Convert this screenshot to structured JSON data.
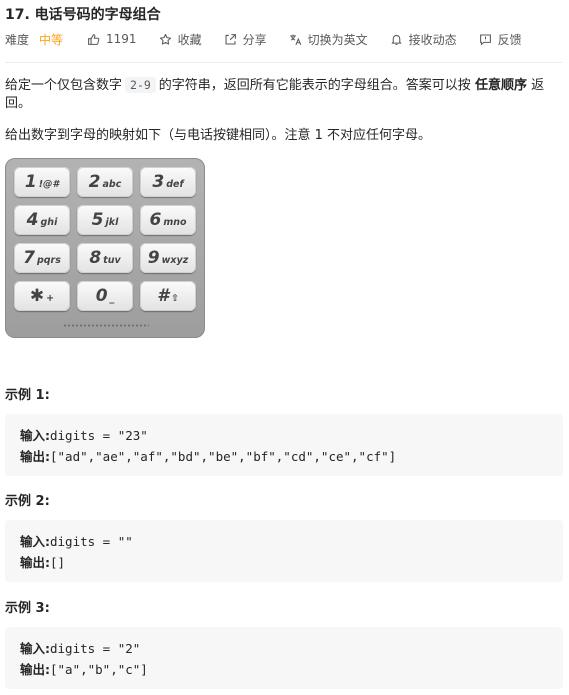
{
  "problem": {
    "title": "17. 电话号码的字母组合",
    "difficulty_label": "难度",
    "difficulty": "中等",
    "likes": "1191",
    "actions": {
      "favorite": "收藏",
      "share": "分享",
      "switch_lang": "切换为英文",
      "subscribe": "接收动态",
      "feedback": "反馈"
    }
  },
  "description": {
    "p1_before": "给定一个仅包含数字",
    "p1_code": "2-9",
    "p1_middle": "的字符串，返回所有它能表示的字母组合。答案可以按",
    "p1_bold": "任意顺序",
    "p1_after": "返回。",
    "p2": "给出数字到字母的映射如下（与电话按键相同）。注意 1 不对应任何字母。"
  },
  "keypad": {
    "keys": [
      {
        "digit": "1",
        "letters": "!@#"
      },
      {
        "digit": "2",
        "letters": "abc"
      },
      {
        "digit": "3",
        "letters": "def"
      },
      {
        "digit": "4",
        "letters": "ghi"
      },
      {
        "digit": "5",
        "letters": "jkl"
      },
      {
        "digit": "6",
        "letters": "mno"
      },
      {
        "digit": "7",
        "letters": "pqrs"
      },
      {
        "digit": "8",
        "letters": "tuv"
      },
      {
        "digit": "9",
        "letters": "wxyz"
      },
      {
        "digit": "✱",
        "letters": "+"
      },
      {
        "digit": "0",
        "letters": "_"
      },
      {
        "digit": "#",
        "letters": "⇧"
      }
    ]
  },
  "examples": [
    {
      "title": "示例 1:",
      "input_label": "输入:",
      "input": "digits = \"23\"",
      "output_label": "输出:",
      "output": "[\"ad\",\"ae\",\"af\",\"bd\",\"be\",\"bf\",\"cd\",\"ce\",\"cf\"]"
    },
    {
      "title": "示例 2:",
      "input_label": "输入:",
      "input": "digits = \"\"",
      "output_label": "输出:",
      "output": "[]"
    },
    {
      "title": "示例 3:",
      "input_label": "输入:",
      "input": "digits = \"2\"",
      "output_label": "输出:",
      "output": "[\"a\",\"b\",\"c\"]"
    }
  ],
  "colors": {
    "difficulty": "#ffa116",
    "text": "#262626",
    "muted": "#595959",
    "example_bg": "#f7f7f8"
  }
}
